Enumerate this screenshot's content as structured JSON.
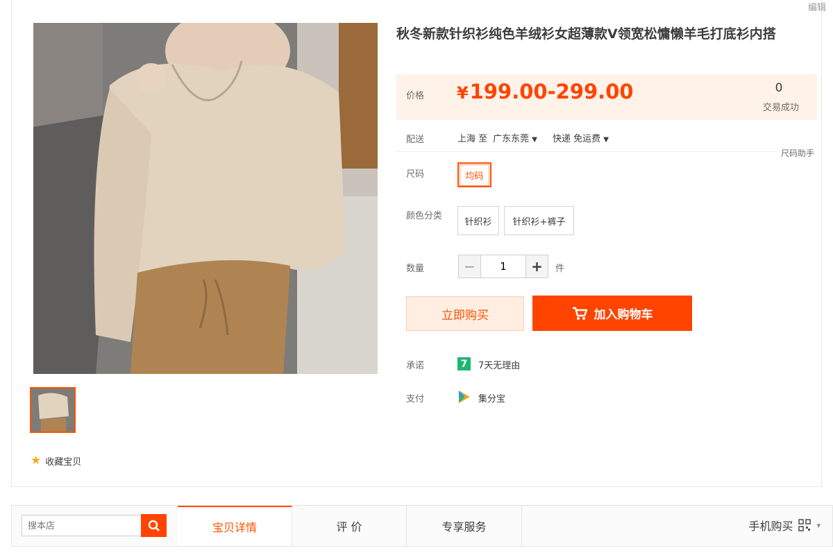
{
  "header": {
    "edit_link": "编辑"
  },
  "product": {
    "title": "秋冬新款针织衫纯色羊绒衫女超薄款V领宽松慵懒羊毛打底衫内搭",
    "price_label": "价格",
    "currency": "¥",
    "price": "199.00-299.00",
    "sales_count": "0",
    "sales_label": "交易成功"
  },
  "shipping": {
    "label": "配送",
    "from": "上海 至",
    "to": "广东东莞",
    "method": "快递 免运费",
    "size_guide": "尺码助手"
  },
  "size": {
    "label": "尺码",
    "options": [
      "均码"
    ],
    "selected": "均码"
  },
  "color": {
    "label": "颜色分类",
    "options": [
      "针织衫",
      "针织衫+裤子"
    ]
  },
  "quantity": {
    "label": "数量",
    "value": "1",
    "unit": "件",
    "minus": "−",
    "plus": "+"
  },
  "actions": {
    "buy_now": "立即购买",
    "add_cart": "加入购物车"
  },
  "promise": {
    "label": "承诺",
    "icon_text": "7",
    "text": "7天无理由"
  },
  "payment": {
    "label": "支付",
    "text": "集分宝"
  },
  "favorite": {
    "text": "收藏宝贝"
  },
  "bottom": {
    "search_placeholder": "搜本店",
    "tabs": [
      "宝贝详情",
      "评 价",
      "专享服务"
    ],
    "active_tab": "宝贝详情",
    "mobile_buy": "手机购买"
  },
  "colors": {
    "accent": "#ff4400",
    "accent_light": "#fff2e8",
    "promise_green": "#1cb76e"
  }
}
